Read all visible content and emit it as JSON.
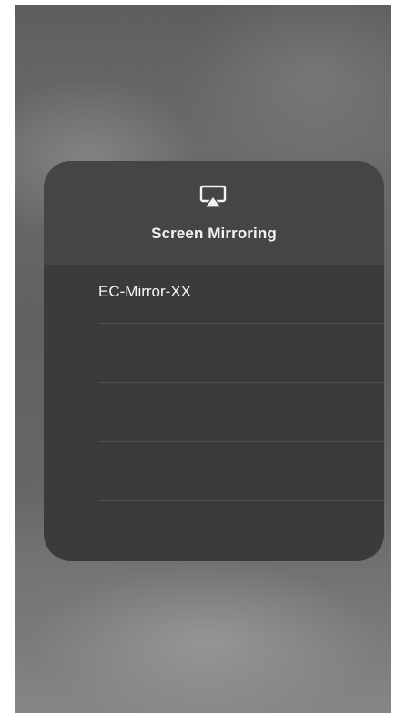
{
  "panel": {
    "icon": "airplay-icon",
    "title": "Screen Mirroring"
  },
  "devices": [
    {
      "label": "EC-Mirror-XX"
    },
    {
      "label": ""
    },
    {
      "label": ""
    },
    {
      "label": ""
    }
  ],
  "colors": {
    "panel_background": "#3b3b3b",
    "panel_header": "#454545",
    "text": "#f2f2f2",
    "divider": "#505050"
  }
}
